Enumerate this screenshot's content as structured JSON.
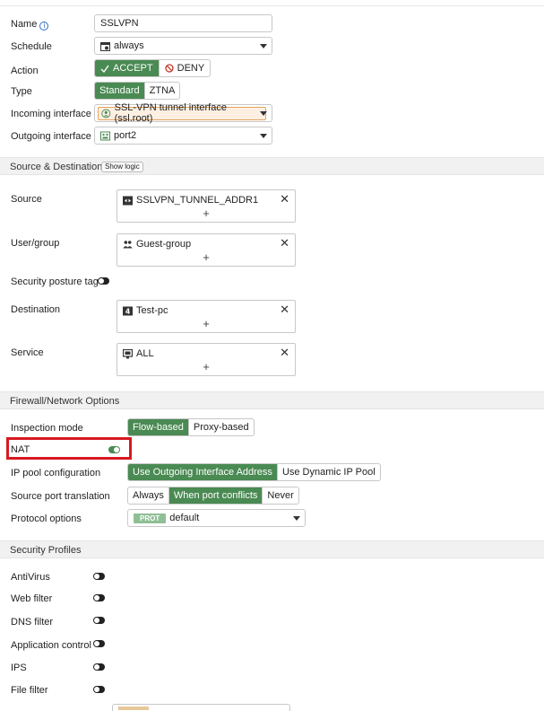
{
  "policy": {
    "name_label": "Name",
    "name_value": "SSLVPN",
    "schedule_label": "Schedule",
    "schedule_value": "always",
    "action_label": "Action",
    "action_options": [
      "ACCEPT",
      "DENY"
    ],
    "type_label": "Type",
    "type_options": [
      "Standard",
      "ZTNA"
    ],
    "incoming_label": "Incoming interface",
    "incoming_value": "SSL-VPN tunnel interface (ssl.root)",
    "outgoing_label": "Outgoing interface",
    "outgoing_value": "port2"
  },
  "source_destination": {
    "section_title": "Source & Destination",
    "show_logic": "Show logic",
    "source_label": "Source",
    "source_item": "SSLVPN_TUNNEL_ADDR1",
    "usergroup_label": "User/group",
    "usergroup_item": "Guest-group",
    "posture_label": "Security posture tag",
    "destination_label": "Destination",
    "destination_item": "Test-pc",
    "service_label": "Service",
    "service_item": "ALL",
    "add_symbol": "+",
    "remove_symbol": "✕"
  },
  "firewall": {
    "section_title": "Firewall/Network Options",
    "inspection_label": "Inspection mode",
    "inspection_options": [
      "Flow-based",
      "Proxy-based"
    ],
    "nat_label": "NAT",
    "ippool_label": "IP pool configuration",
    "ippool_options": [
      "Use Outgoing Interface Address",
      "Use Dynamic IP Pool"
    ],
    "srcport_label": "Source port translation",
    "srcport_options": [
      "Always",
      "When port conflicts",
      "Never"
    ],
    "protocol_label": "Protocol options",
    "protocol_badge": "PROT",
    "protocol_value": "default"
  },
  "security_profiles": {
    "section_title": "Security Profiles",
    "antivirus": "AntiVirus",
    "webfilter": "Web filter",
    "dnsfilter": "DNS filter",
    "appcontrol": "Application control",
    "ips": "IPS",
    "filefilter": "File filter"
  },
  "colors": {
    "accent_green": "#4a8a53",
    "highlight_red": "#d71920",
    "incoming_bg": "#fdf0e3",
    "incoming_border": "#e4a35a"
  }
}
